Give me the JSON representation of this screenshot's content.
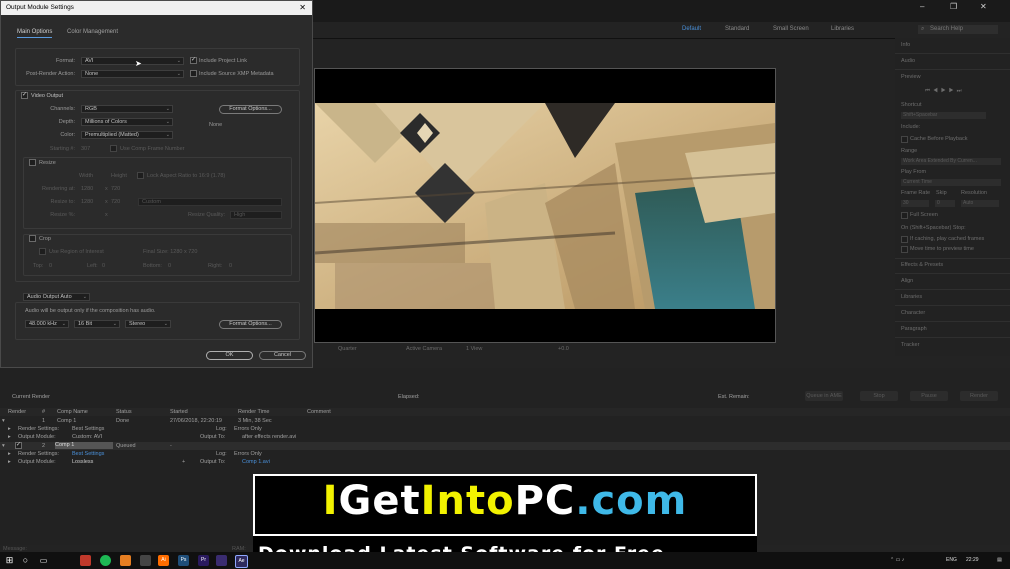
{
  "workspace": {
    "tabs": [
      "Default",
      "Standard",
      "Small Screen",
      "Libraries"
    ],
    "active": "Default",
    "search_placeholder": "Search Help"
  },
  "window_controls": {
    "minimize": "–",
    "maximize": "❐",
    "close": "✕"
  },
  "dialog": {
    "title": "Output Module Settings",
    "close": "✕",
    "tabs": [
      "Main Options",
      "Color Management"
    ],
    "format_label": "Format:",
    "format_value": "AVI",
    "include_project_link": "Include Project Link",
    "post_render_label": "Post-Render Action:",
    "post_render_value": "None",
    "include_xmp": "Include Source XMP Metadata",
    "video_output": "Video Output",
    "channels_label": "Channels:",
    "channels_value": "RGB",
    "format_options_button": "Format Options...",
    "depth_label": "Depth:",
    "depth_value": "Millions of Colors",
    "none_label": "None",
    "color_label": "Color:",
    "color_value": "Premultiplied (Matted)",
    "starting_label": "Starting #:",
    "starting_value": "307",
    "use_comp_frame": "Use Comp Frame Number",
    "resize": "Resize",
    "width_label": "Width",
    "height_label": "Height",
    "lock_aspect": "Lock Aspect Ratio to 16:9 (1.78)",
    "rendering_at_label": "Rendering at:",
    "rendering_w": "1280",
    "rendering_h": "720",
    "resize_to_label": "Resize to:",
    "resize_w": "1280",
    "resize_h": "720",
    "resize_preset": "Custom",
    "resize_pct_label": "Resize %:",
    "resize_quality_label": "Resize Quality:",
    "resize_quality_value": "High",
    "x": "x",
    "crop": "Crop",
    "use_roi": "Use Region of Interest",
    "final_size": "Final Size: 1280 x 720",
    "top_label": "Top:",
    "top_value": "0",
    "left_label": "Left:",
    "left_value": "0",
    "bottom_label": "Bottom:",
    "bottom_value": "0",
    "right_label": "Right:",
    "right_value": "0",
    "audio_output": "Audio Output Auto",
    "audio_note": "Audio will be output only if the composition has audio.",
    "sample_rate": "48.000 kHz",
    "bit_depth": "16 Bit",
    "channels_audio": "Stereo",
    "audio_format_options": "Format Options...",
    "ok": "OK",
    "cancel": "Cancel"
  },
  "viewer_toolbar": {
    "quality": "Quarter",
    "camera": "Active Camera",
    "views": "1 View",
    "exposure": "+0.0"
  },
  "right_panel": {
    "info": "Info",
    "audio": "Audio",
    "preview": "Preview",
    "shortcut": "Shortcut",
    "shortcut_value": "Shift+Spacebar",
    "include": "Include:",
    "cache_before": "Cache Before Playback",
    "range": "Range",
    "range_value": "Work Area Extended By Curren...",
    "play_from": "Play From",
    "play_from_value": "Current Time",
    "frame_rate": "Frame Rate",
    "skip": "Skip",
    "resolution": "Resolution",
    "frame_rate_value": "30",
    "skip_value": "0",
    "resolution_value": "Auto",
    "full_screen": "Full Screen",
    "on_stop": "On (Shift+Spacebar) Stop:",
    "if_caching": "If caching, play cached frames",
    "move_time": "Move time to preview time",
    "effects": "Effects & Presets",
    "align": "Align",
    "libraries": "Libraries",
    "character": "Character",
    "paragraph": "Paragraph",
    "tracker": "Tracker"
  },
  "render_queue": {
    "current_render": "Current Render",
    "elapsed": "Elapsed:",
    "est_remain": "Est. Remain:",
    "buttons": [
      "Queue in AME",
      "Stop",
      "Pause",
      "Render"
    ],
    "columns": [
      "Render",
      "#",
      "Comp Name",
      "Status",
      "Started",
      "Render Time",
      "Comment"
    ],
    "items": [
      {
        "num": "1",
        "name": "Comp 1",
        "status": "Done",
        "started": "27/06/2018, 22:20:19",
        "render_time": "3 Min, 38 Sec",
        "render_settings_label": "Render Settings:",
        "render_settings": "Best Settings",
        "log_label": "Log:",
        "log": "Errors Only",
        "output_module_label": "Output Module:",
        "output_module": "Custom: AVI",
        "output_to_label": "Output To:",
        "output_to": "after effects render.avi"
      },
      {
        "num": "2",
        "name": "Comp 1",
        "status": "Queued",
        "started": "-",
        "render_time": "",
        "render_settings_label": "Render Settings:",
        "render_settings": "Best Settings",
        "log_label": "Log:",
        "log": "Errors Only",
        "output_module_label": "Output Module:",
        "output_module": "Lossless",
        "output_to_label": "Output To:",
        "output_to": "Comp 1.avi"
      }
    ]
  },
  "banner": {
    "main_I": "I",
    "main_Get": "Get",
    "main_Into": "Into",
    "main_PC": "PC",
    "main_com": ".com",
    "sub": "Download Latest Software for Free"
  },
  "status": {
    "message": "Message:",
    "ram": "RAM:"
  },
  "taskbar": {
    "lang": "ENG",
    "time": "22:29"
  }
}
